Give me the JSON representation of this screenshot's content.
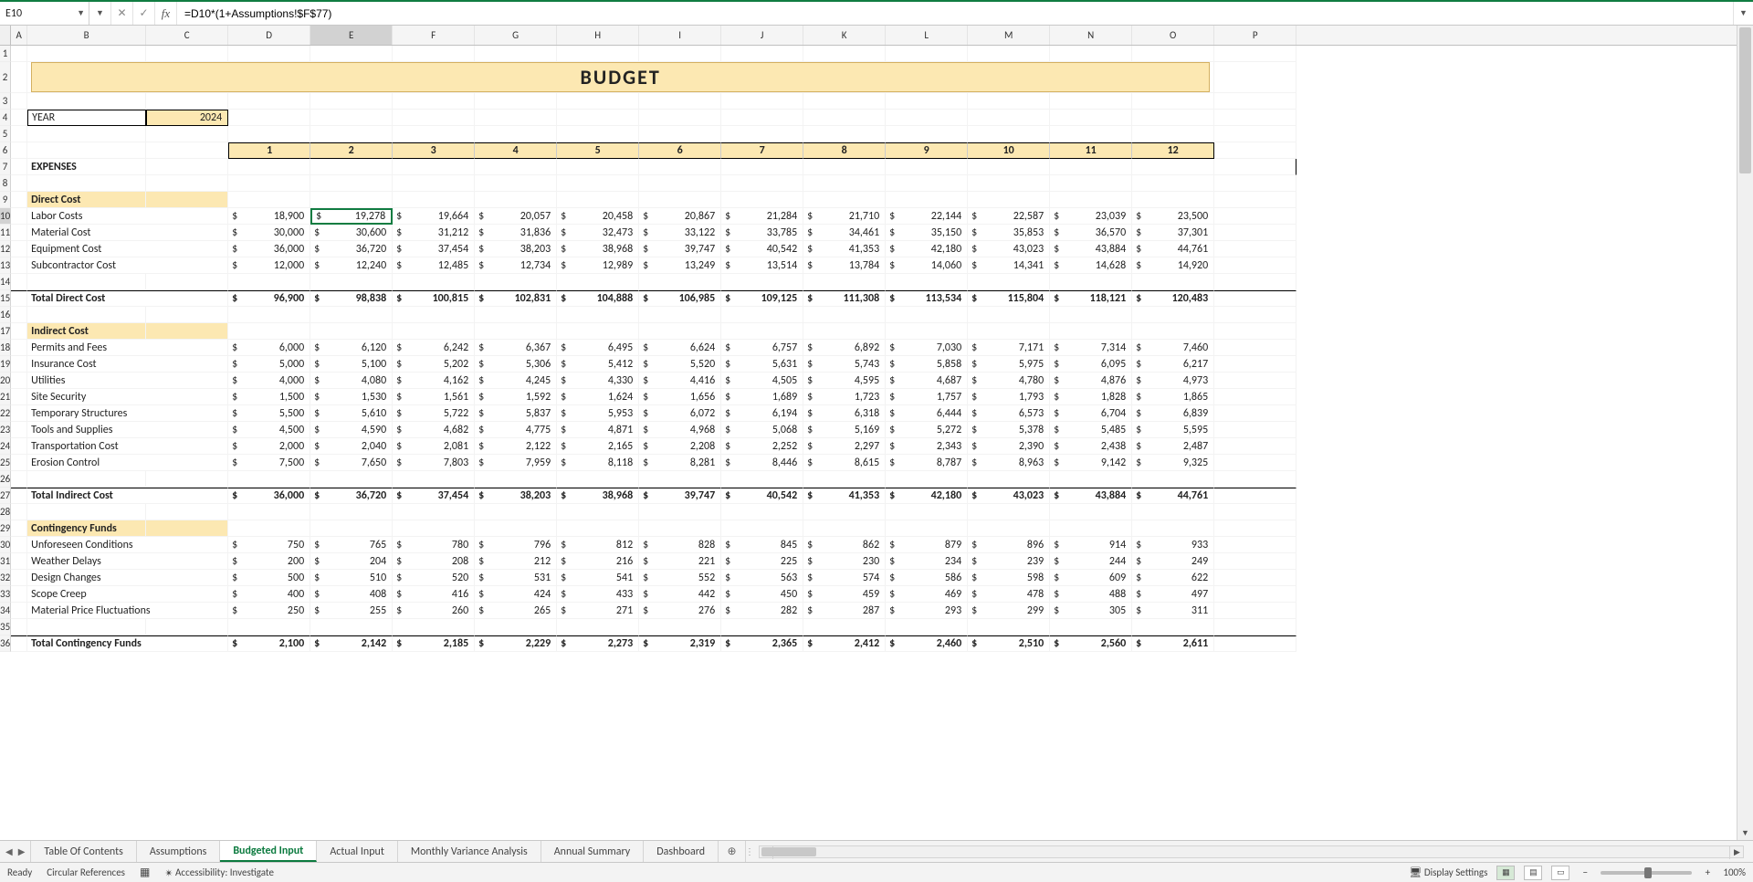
{
  "name_box": "E10",
  "formula": "=D10*(1+Assumptions!$F$77)",
  "col_letters": [
    "A",
    "B",
    "C",
    "D",
    "E",
    "F",
    "G",
    "H",
    "I",
    "J",
    "K",
    "L",
    "M",
    "N",
    "O",
    "P"
  ],
  "active_col": "E",
  "active_row": 10,
  "rows_visible": [
    1,
    2,
    3,
    4,
    5,
    6,
    7,
    8,
    9,
    10,
    11,
    12,
    13,
    14,
    15,
    16,
    17,
    18,
    19,
    20,
    21,
    22,
    23,
    24,
    25,
    26,
    27,
    28,
    29,
    30,
    31,
    32,
    33,
    34,
    35,
    36
  ],
  "title": "BUDGET",
  "year_label": "YEAR",
  "year_value": "2024",
  "months": [
    "1",
    "2",
    "3",
    "4",
    "5",
    "6",
    "7",
    "8",
    "9",
    "10",
    "11",
    "12"
  ],
  "heading_expenses": "EXPENSES",
  "sections": {
    "direct": {
      "title": "Direct Cost",
      "rows": [
        {
          "label": "Labor Costs",
          "v": [
            "18,900",
            "19,278",
            "19,664",
            "20,057",
            "20,458",
            "20,867",
            "21,284",
            "21,710",
            "22,144",
            "22,587",
            "23,039",
            "23,500"
          ]
        },
        {
          "label": "Material Cost",
          "v": [
            "30,000",
            "30,600",
            "31,212",
            "31,836",
            "32,473",
            "33,122",
            "33,785",
            "34,461",
            "35,150",
            "35,853",
            "36,570",
            "37,301"
          ]
        },
        {
          "label": "Equipment Cost",
          "v": [
            "36,000",
            "36,720",
            "37,454",
            "38,203",
            "38,968",
            "39,747",
            "40,542",
            "41,353",
            "42,180",
            "43,023",
            "43,884",
            "44,761"
          ]
        },
        {
          "label": "Subcontractor Cost",
          "v": [
            "12,000",
            "12,240",
            "12,485",
            "12,734",
            "12,989",
            "13,249",
            "13,514",
            "13,784",
            "14,060",
            "14,341",
            "14,628",
            "14,920"
          ]
        }
      ],
      "total_label": "Total Direct Cost",
      "total": [
        "96,900",
        "98,838",
        "100,815",
        "102,831",
        "104,888",
        "106,985",
        "109,125",
        "111,308",
        "113,534",
        "115,804",
        "118,121",
        "120,483"
      ]
    },
    "indirect": {
      "title": "Indirect Cost",
      "rows": [
        {
          "label": "Permits and Fees",
          "v": [
            "6,000",
            "6,120",
            "6,242",
            "6,367",
            "6,495",
            "6,624",
            "6,757",
            "6,892",
            "7,030",
            "7,171",
            "7,314",
            "7,460"
          ]
        },
        {
          "label": "Insurance Cost",
          "v": [
            "5,000",
            "5,100",
            "5,202",
            "5,306",
            "5,412",
            "5,520",
            "5,631",
            "5,743",
            "5,858",
            "5,975",
            "6,095",
            "6,217"
          ]
        },
        {
          "label": "Utilities",
          "v": [
            "4,000",
            "4,080",
            "4,162",
            "4,245",
            "4,330",
            "4,416",
            "4,505",
            "4,595",
            "4,687",
            "4,780",
            "4,876",
            "4,973"
          ]
        },
        {
          "label": "Site Security",
          "v": [
            "1,500",
            "1,530",
            "1,561",
            "1,592",
            "1,624",
            "1,656",
            "1,689",
            "1,723",
            "1,757",
            "1,793",
            "1,828",
            "1,865"
          ]
        },
        {
          "label": "Temporary Structures",
          "v": [
            "5,500",
            "5,610",
            "5,722",
            "5,837",
            "5,953",
            "6,072",
            "6,194",
            "6,318",
            "6,444",
            "6,573",
            "6,704",
            "6,839"
          ]
        },
        {
          "label": "Tools and Supplies",
          "v": [
            "4,500",
            "4,590",
            "4,682",
            "4,775",
            "4,871",
            "4,968",
            "5,068",
            "5,169",
            "5,272",
            "5,378",
            "5,485",
            "5,595"
          ]
        },
        {
          "label": "Transportation Cost",
          "v": [
            "2,000",
            "2,040",
            "2,081",
            "2,122",
            "2,165",
            "2,208",
            "2,252",
            "2,297",
            "2,343",
            "2,390",
            "2,438",
            "2,487"
          ]
        },
        {
          "label": "Erosion Control",
          "v": [
            "7,500",
            "7,650",
            "7,803",
            "7,959",
            "8,118",
            "8,281",
            "8,446",
            "8,615",
            "8,787",
            "8,963",
            "9,142",
            "9,325"
          ]
        }
      ],
      "total_label": "Total Indirect Cost",
      "total": [
        "36,000",
        "36,720",
        "37,454",
        "38,203",
        "38,968",
        "39,747",
        "40,542",
        "41,353",
        "42,180",
        "43,023",
        "43,884",
        "44,761"
      ]
    },
    "cont": {
      "title": "Contingency Funds",
      "rows": [
        {
          "label": "Unforeseen Conditions",
          "v": [
            "750",
            "765",
            "780",
            "796",
            "812",
            "828",
            "845",
            "862",
            "879",
            "896",
            "914",
            "933"
          ]
        },
        {
          "label": "Weather Delays",
          "v": [
            "200",
            "204",
            "208",
            "212",
            "216",
            "221",
            "225",
            "230",
            "234",
            "239",
            "244",
            "249"
          ]
        },
        {
          "label": "Design Changes",
          "v": [
            "500",
            "510",
            "520",
            "531",
            "541",
            "552",
            "563",
            "574",
            "586",
            "598",
            "609",
            "622"
          ]
        },
        {
          "label": "Scope Creep",
          "v": [
            "400",
            "408",
            "416",
            "424",
            "433",
            "442",
            "450",
            "459",
            "469",
            "478",
            "488",
            "497"
          ]
        },
        {
          "label": "Material Price Fluctuations",
          "v": [
            "250",
            "255",
            "260",
            "265",
            "271",
            "276",
            "282",
            "287",
            "293",
            "299",
            "305",
            "311"
          ]
        }
      ],
      "total_label": "Total Contingency Funds",
      "total": [
        "2,100",
        "2,142",
        "2,185",
        "2,229",
        "2,273",
        "2,319",
        "2,365",
        "2,412",
        "2,460",
        "2,510",
        "2,560",
        "2,611"
      ]
    }
  },
  "tabs": [
    "Table Of Contents",
    "Assumptions",
    "Budgeted Input",
    "Actual Input",
    "Monthly Variance Analysis",
    "Annual Summary",
    "Dashboard"
  ],
  "active_tab": 2,
  "status": {
    "ready": "Ready",
    "circ": "Circular References",
    "access": "Accessibility: Investigate",
    "display": "Display Settings",
    "zoom": "100%"
  }
}
